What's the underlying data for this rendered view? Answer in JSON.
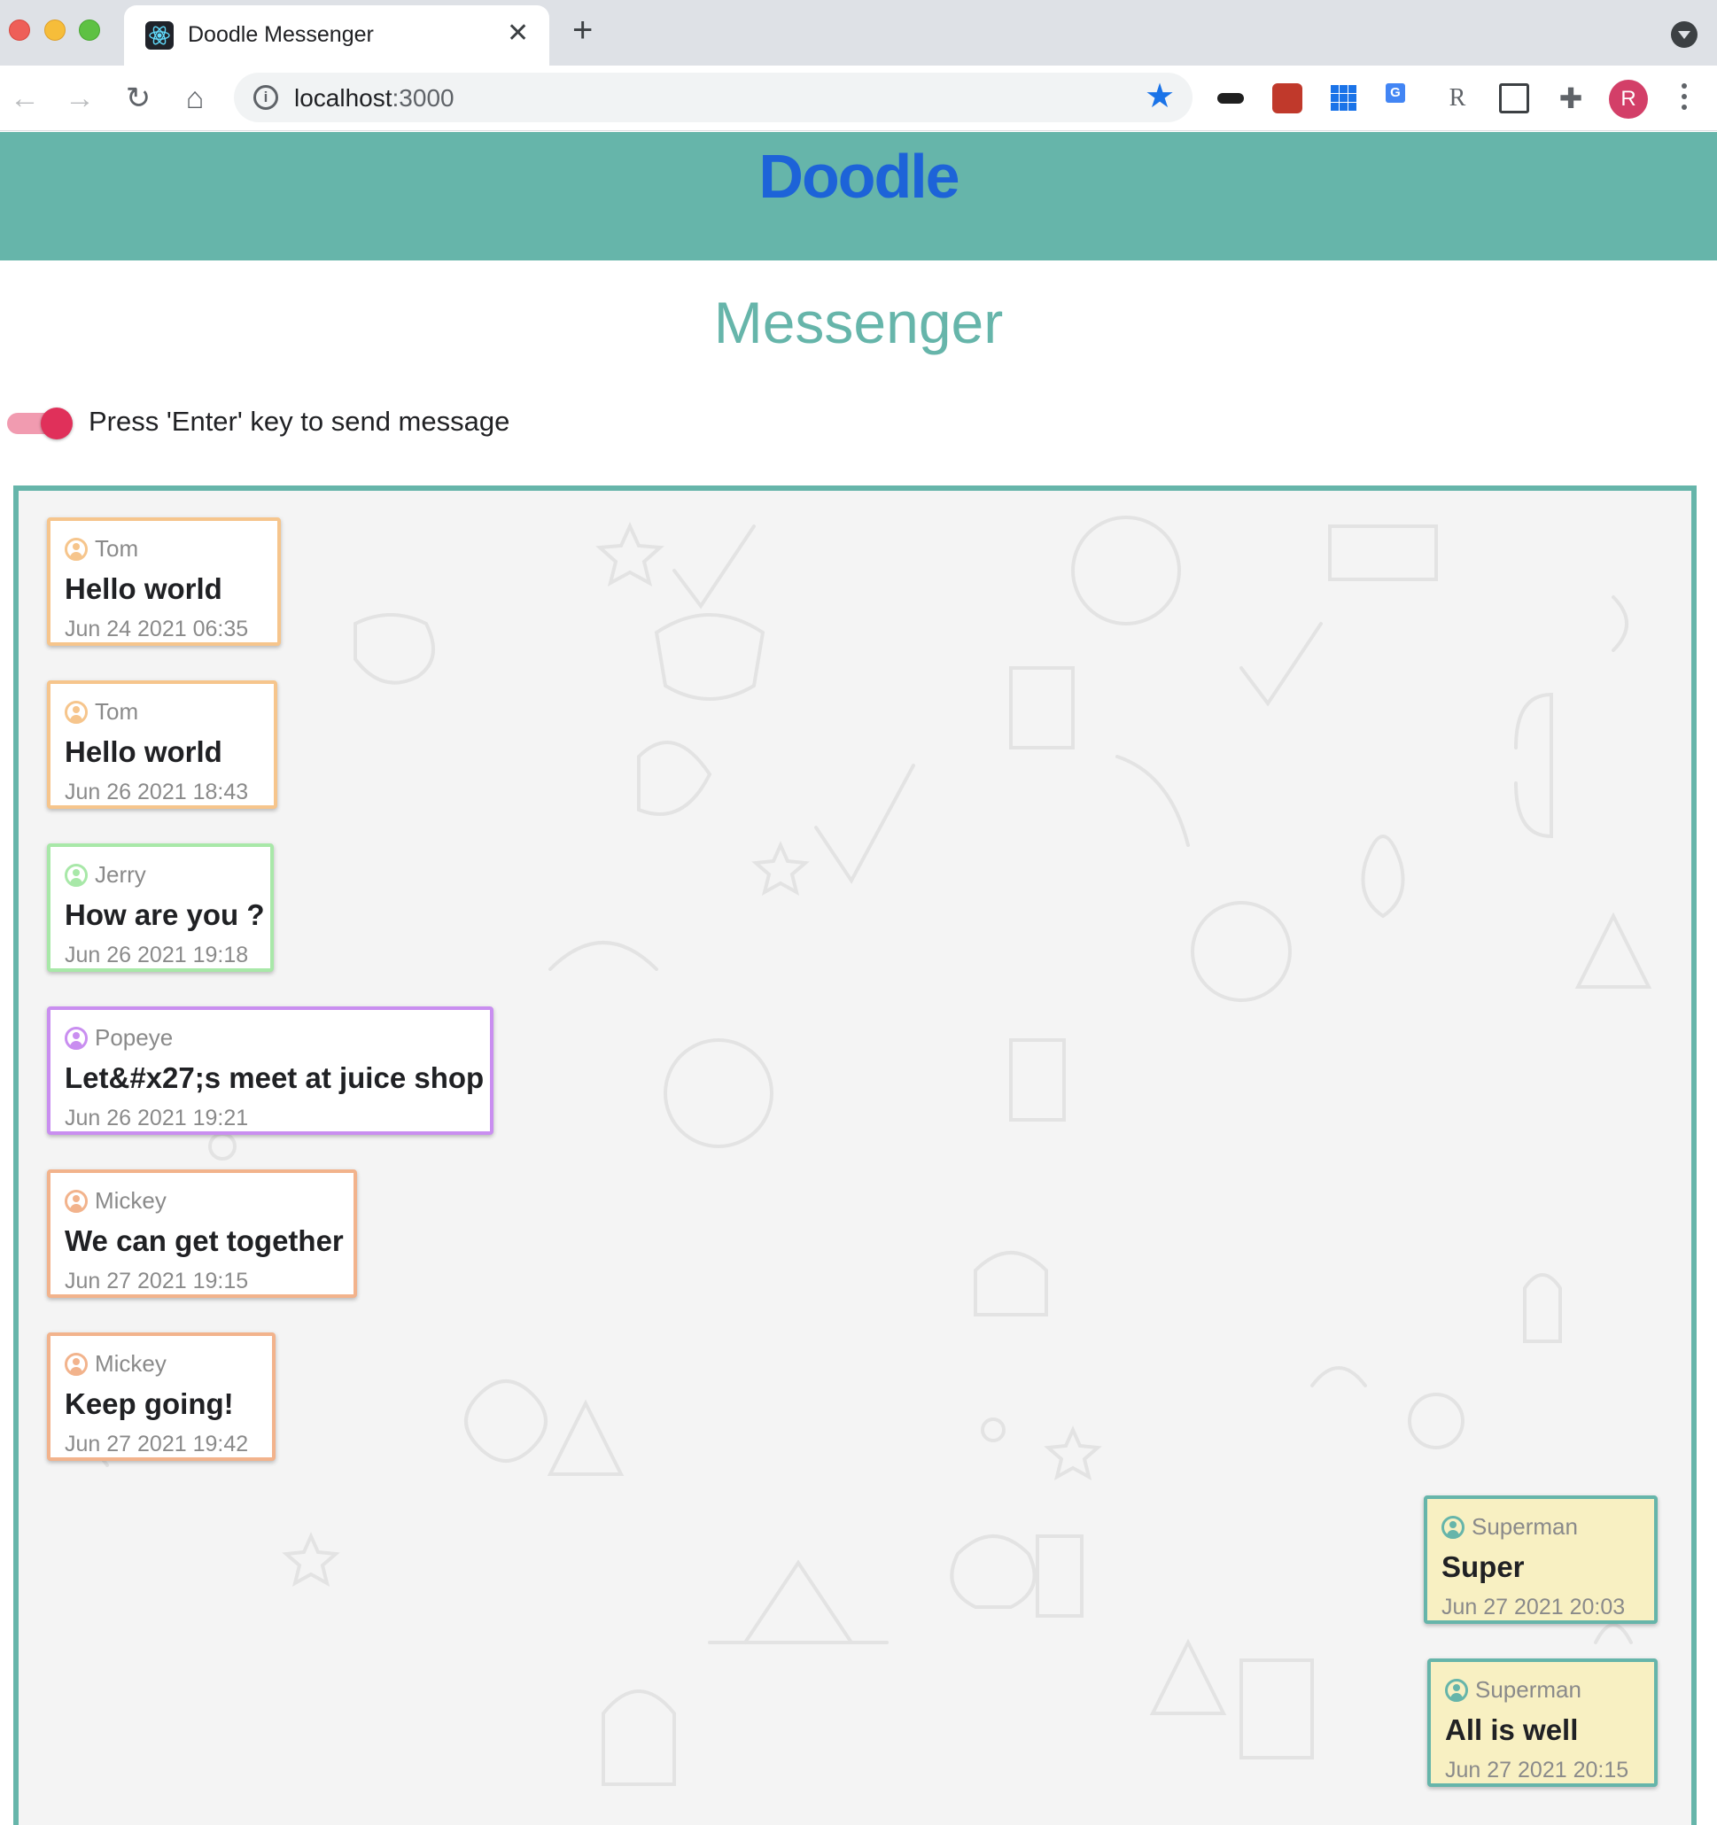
{
  "browser": {
    "tab_title": "Doodle Messenger",
    "tab_close": "✕",
    "new_tab": "+",
    "url_host": "localhost",
    "url_port": ":3000",
    "profile_initial": "R",
    "nav": {
      "back": "←",
      "forward": "→",
      "reload": "↻",
      "home": "⌂"
    },
    "bookmark_star": "★"
  },
  "app": {
    "logo": "Doodle",
    "page_title": "Messenger",
    "toggle_label": "Press 'Enter' key to send message",
    "toggle_on": true,
    "colors": {
      "header": "#66b5aa",
      "logo": "#1d63d8",
      "toggle": "#e0305a",
      "superman_bubble": "#f8f0c2"
    }
  },
  "messages": [
    {
      "author": "Tom",
      "text": "Hello world",
      "time": "Jun 24 2021 06:35",
      "side": "left",
      "icon": "user-circle-icon"
    },
    {
      "author": "Tom",
      "text": "Hello world",
      "time": "Jun 26 2021 18:43",
      "side": "left",
      "icon": "user-circle-icon"
    },
    {
      "author": "Jerry",
      "text": "How are you ?",
      "time": "Jun 26 2021 19:18",
      "side": "left",
      "icon": "user-circle-icon"
    },
    {
      "author": "Popeye",
      "text": "Let&#x27;s meet at juice shop",
      "time": "Jun 26 2021 19:21",
      "side": "left",
      "icon": "user-circle-icon"
    },
    {
      "author": "Mickey",
      "text": "We can get together",
      "time": "Jun 27 2021 19:15",
      "side": "left",
      "icon": "user-circle-icon"
    },
    {
      "author": "Mickey",
      "text": "Keep going!",
      "time": "Jun 27 2021 19:42",
      "side": "left",
      "icon": "user-circle-icon"
    },
    {
      "author": "Superman",
      "text": "Super",
      "time": "Jun 27 2021 20:03",
      "side": "right",
      "icon": "user-circle-icon"
    },
    {
      "author": "Superman",
      "text": "All is well",
      "time": "Jun 27 2021 20:15",
      "side": "right",
      "icon": "user-circle-icon"
    }
  ]
}
